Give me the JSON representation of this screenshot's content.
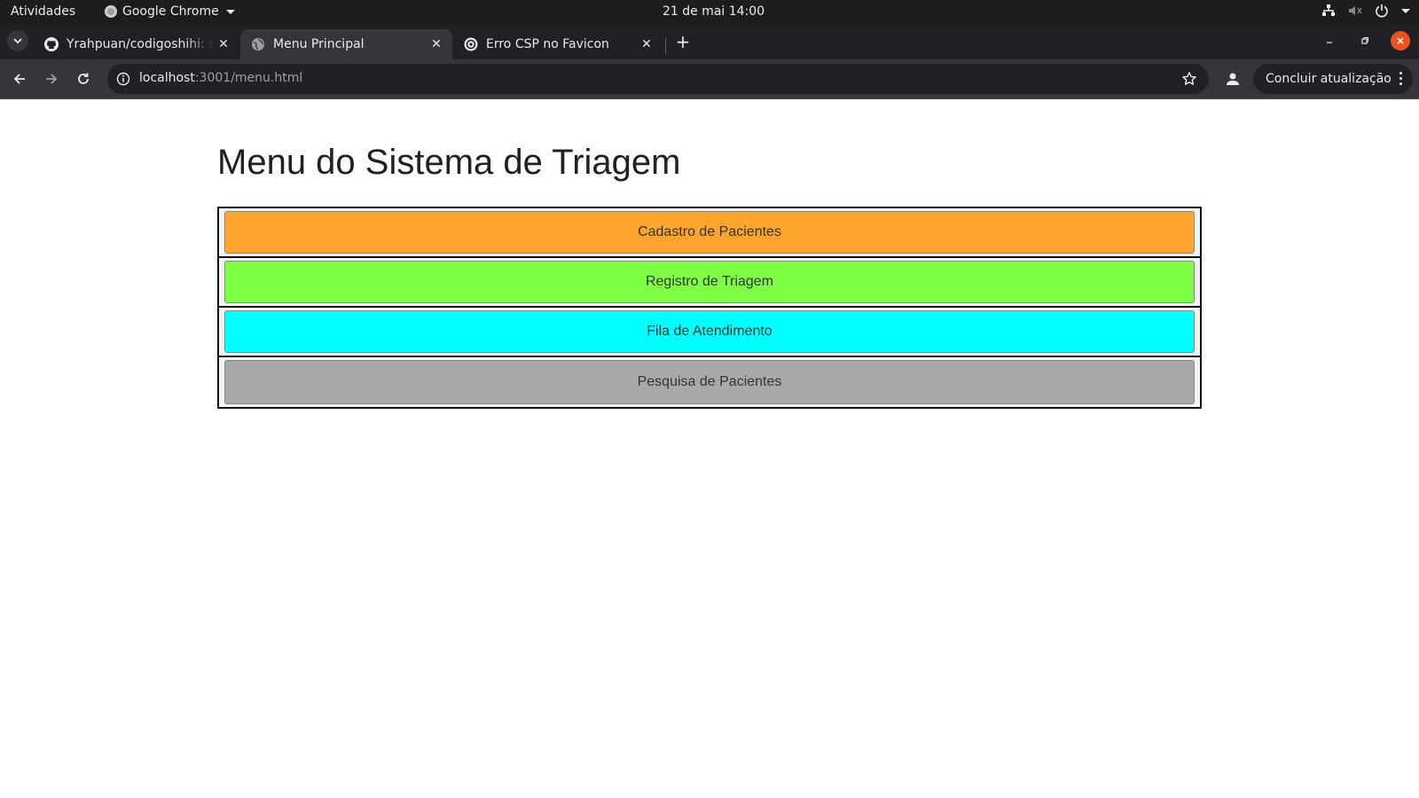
{
  "system_bar": {
    "activities": "Atividades",
    "app_name": "Google Chrome",
    "clock": "21 de mai  14:00"
  },
  "tabs": [
    {
      "title": "Yrahpuan/codigoshihi: sl",
      "favicon": "github-icon",
      "active": false
    },
    {
      "title": "Menu Principal",
      "favicon": "globe-icon",
      "active": true
    },
    {
      "title": "Erro CSP no Favicon",
      "favicon": "openai-icon",
      "active": false
    }
  ],
  "toolbar": {
    "url_host": "localhost",
    "url_path": ":3001/menu.html",
    "update_label": "Concluir atualização"
  },
  "page": {
    "title": "Menu do Sistema de Triagem",
    "menu": [
      {
        "label": "Cadastro de Pacientes",
        "color": "#ffa42c"
      },
      {
        "label": "Registro de Triagem",
        "color": "#7fff43"
      },
      {
        "label": "Fila de Atendimento",
        "color": "#00ffff"
      },
      {
        "label": "Pesquisa de Pacientes",
        "color": "#a9a9a9"
      }
    ]
  },
  "colors": {
    "accent_close": "#e95420",
    "chrome_dark": "#202124",
    "chrome_toolbar": "#35363a"
  }
}
